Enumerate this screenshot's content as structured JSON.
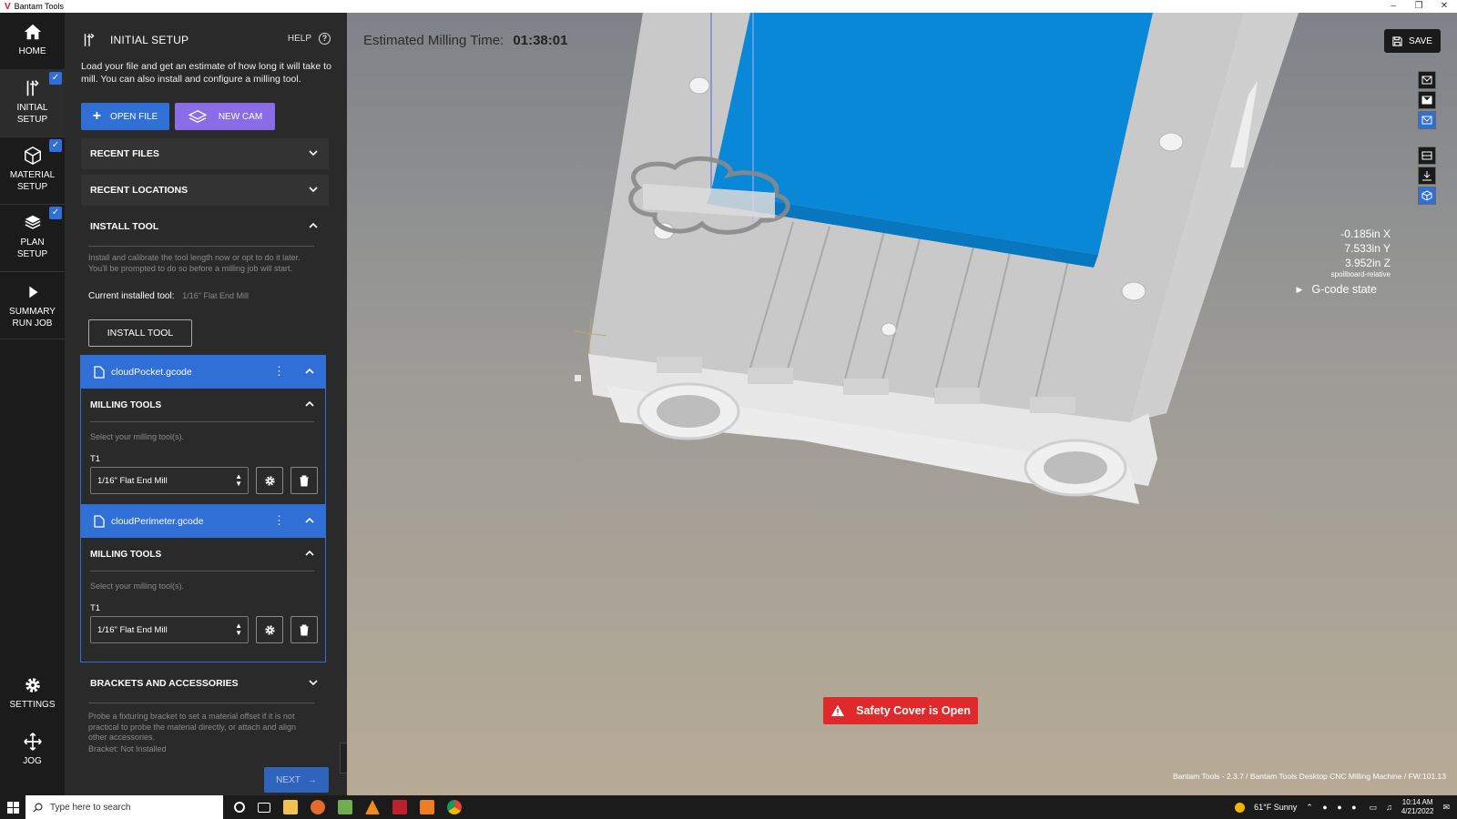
{
  "window": {
    "title": "Bantam Tools"
  },
  "nav": {
    "home": "HOME",
    "initial_setup": [
      "INITIAL",
      "SETUP"
    ],
    "material_setup": [
      "MATERIAL",
      "SETUP"
    ],
    "plan_setup": [
      "PLAN",
      "SETUP"
    ],
    "summary": [
      "SUMMARY",
      "RUN JOB"
    ],
    "settings": "SETTINGS",
    "jog": "JOG"
  },
  "panel": {
    "title": "INITIAL SETUP",
    "help": "HELP",
    "intro": "Load your file and get an estimate of how long it will take to mill. You can also install and configure a milling tool.",
    "open_file": "OPEN FILE",
    "new_cam": "NEW CAM",
    "recent_files": "RECENT FILES",
    "recent_locations": "RECENT LOCATIONS",
    "install_tool": {
      "heading": "INSTALL TOOL",
      "description": "Install and calibrate the tool length now or opt to do it later. You'll be prompted to do so before a milling job will start.",
      "current_label": "Current installed tool:",
      "current_value": "1/16\" Flat End Mill",
      "button": "INSTALL TOOL"
    },
    "files": [
      {
        "name": "cloudPocket.gcode",
        "section": "MILLING TOOLS",
        "hint": "Select your milling tool(s).",
        "tool_label": "T1",
        "tool_value": "1/16\" Flat End Mill"
      },
      {
        "name": "cloudPerimeter.gcode",
        "section": "MILLING TOOLS",
        "hint": "Select your milling tool(s).",
        "tool_label": "T1",
        "tool_value": "1/16\" Flat End Mill"
      }
    ],
    "brackets": {
      "heading": "BRACKETS AND ACCESSORIES",
      "description": "Probe a fixturing bracket to set a material offset if it is not practical to probe the material directly, or attach and align other accessories.",
      "status": "Bracket: Not Installed"
    },
    "next": "NEXT"
  },
  "viewport": {
    "estimate_label": "Estimated Milling Time:",
    "estimate_value": "01:38:01",
    "save": "SAVE",
    "coords": {
      "x": "-0.185in X",
      "y": "7.533in Y",
      "z": "3.952in Z",
      "relative": "spoilboard-relative"
    },
    "gcode_state": "G-code state",
    "safety_warning": "Safety Cover is Open",
    "version": "Bantam Tools - 2.3.7 / Bantam Tools Desktop CNC Milling Machine / FW:101.13"
  },
  "taskbar": {
    "search_placeholder": "Type here to search",
    "weather": "61°F  Sunny",
    "time": "10:14 AM",
    "date": "4/21/2022"
  },
  "colors": {
    "accent": "#2f6fd6",
    "cam": "#8b6ce8",
    "warning": "#e0292a",
    "material": "#0a88d8"
  }
}
